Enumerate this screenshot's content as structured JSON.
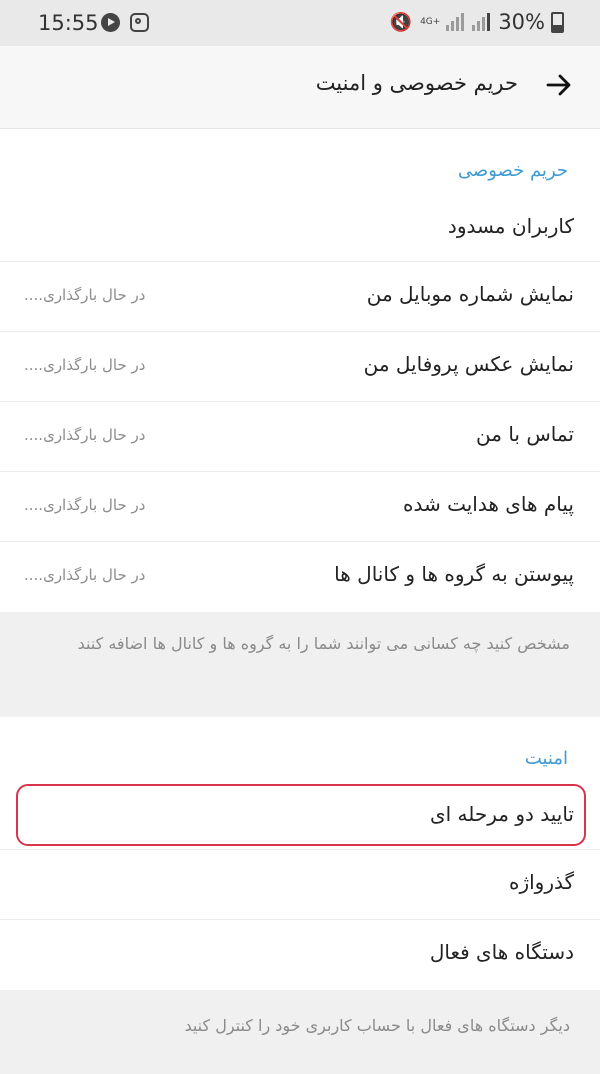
{
  "status_bar": {
    "time": "15:55",
    "network": "4G+",
    "battery": "30%"
  },
  "header": {
    "title": "حریم خصوصی و امنیت",
    "back_icon": "arrow-right-icon"
  },
  "privacy": {
    "section_title": "حریم خصوصی",
    "items": [
      {
        "label": "کاربران مسدود",
        "value": ""
      },
      {
        "label": "نمایش شماره موبایل من",
        "value": "در حال بارگذاری...."
      },
      {
        "label": "نمایش عکس پروفایل من",
        "value": "در حال بارگذاری...."
      },
      {
        "label": "تماس با من",
        "value": "در حال بارگذاری...."
      },
      {
        "label": "پیام های هدایت شده",
        "value": "در حال بارگذاری...."
      },
      {
        "label": "پیوستن به گروه ها و کانال ها",
        "value": "در حال بارگذاری...."
      }
    ],
    "footer": "مشخص کنید چه کسانی می توانند شما را به گروه ها و کانال ها اضافه کنند"
  },
  "security": {
    "section_title": "امنیت",
    "items": [
      {
        "label": "تایید دو مرحله ای"
      },
      {
        "label": "گذرواژه"
      },
      {
        "label": "دستگاه های فعال"
      }
    ],
    "footer": "دیگر دستگاه های فعال با حساب کاربری خود را کنترل کنید"
  },
  "colors": {
    "accent": "#3f9bd1",
    "highlight": "#d8344a"
  }
}
